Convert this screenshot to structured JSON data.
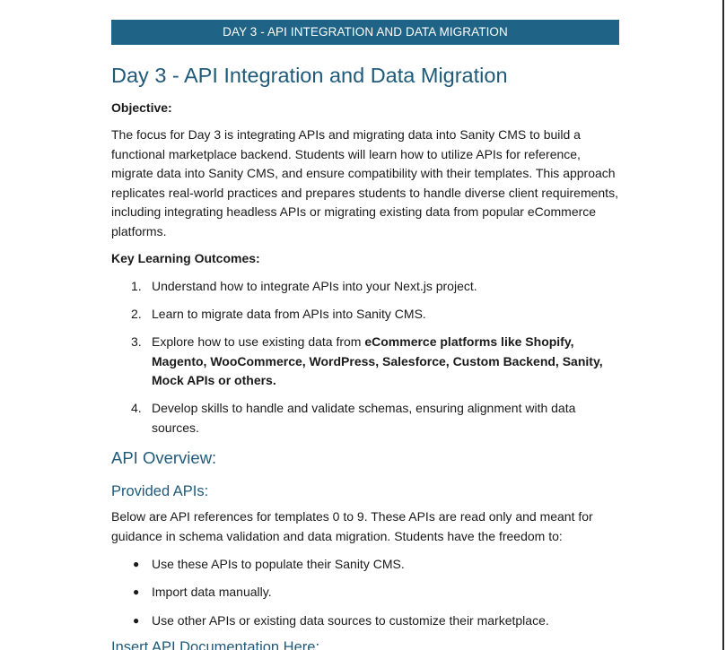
{
  "banner": "DAY 3 - API INTEGRATION AND DATA MIGRATION",
  "title": "Day 3 - API Integration and Data Migration",
  "objective": {
    "label": "Objective:",
    "text": "The focus for Day 3 is integrating APIs and migrating data into Sanity CMS to build a functional marketplace backend. Students will learn how to utilize APIs for reference, migrate data into Sanity CMS, and ensure compatibility with their templates. This approach replicates real-world practices and prepares students to handle diverse client requirements, including integrating headless APIs or migrating existing data from popular eCommerce platforms."
  },
  "outcomes": {
    "label": "Key Learning Outcomes:",
    "items": [
      {
        "num": "1.",
        "text": "Understand how to integrate APIs into your Next.js project."
      },
      {
        "num": "2.",
        "text": "Learn to migrate data from APIs into Sanity CMS."
      },
      {
        "num": "3.",
        "text_pre": "Explore how to use existing data from ",
        "text_bold": "eCommerce platforms like Shopify, Magento, WooCommerce, WordPress, Salesforce, Custom Backend, Sanity, Mock APIs or others."
      },
      {
        "num": "4.",
        "text": "Develop skills to handle and validate schemas, ensuring alignment with data sources."
      }
    ]
  },
  "api_overview": {
    "heading": "API Overview:",
    "provided_heading": "Provided APIs:",
    "intro": "Below are API references for templates 0 to 9. These APIs are read only and meant for guidance in schema validation and data migration. Students have the freedom to:",
    "bullets": [
      "Use these APIs to populate their Sanity CMS.",
      "Import data manually.",
      "Use other APIs or existing data sources to customize their marketplace."
    ],
    "next_heading": "Insert API Documentation Here:"
  }
}
